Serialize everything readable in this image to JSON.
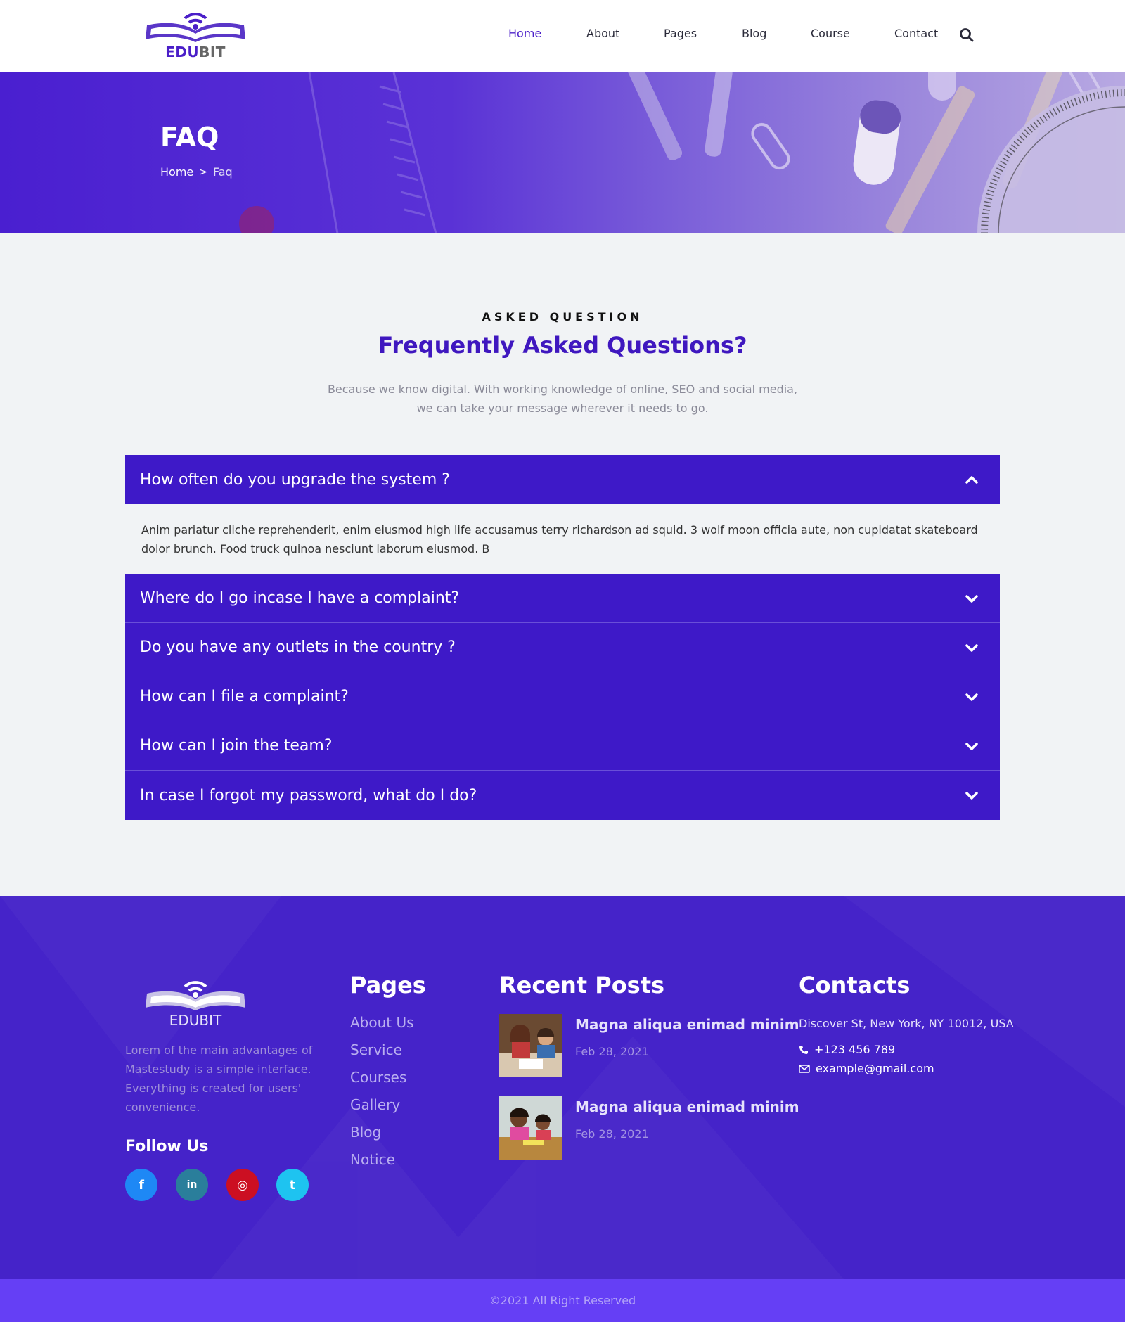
{
  "header": {
    "logo": {
      "part1": "EDU",
      "part2": "BIT"
    },
    "nav": [
      {
        "label": "Home",
        "active": true
      },
      {
        "label": "About",
        "active": false
      },
      {
        "label": "Pages",
        "active": false
      },
      {
        "label": "Blog",
        "active": false
      },
      {
        "label": "Course",
        "active": false
      },
      {
        "label": "Contact",
        "active": false
      }
    ],
    "search_icon": "search-icon"
  },
  "banner": {
    "title": "FAQ",
    "breadcrumb": {
      "home": "Home",
      "separator": ">",
      "current": "Faq"
    }
  },
  "faq": {
    "eyebrow": "ASKED QUESTION",
    "title": "Frequently Asked Questions?",
    "description_line1": "Because we know digital. With working knowledge of online, SEO and social media,",
    "description_line2": "we can take your message wherever it needs to go.",
    "items": [
      {
        "question": "How often do you upgrade the system ?",
        "expanded": true,
        "answer": "Anim pariatur cliche reprehenderit, enim eiusmod high life accusamus terry richardson ad squid. 3 wolf moon officia aute, non cupidatat skateboard dolor brunch. Food truck quinoa nesciunt laborum eiusmod. B"
      },
      {
        "question": "Where do I go incase I have a complaint?",
        "expanded": false
      },
      {
        "question": "Do you have any outlets in the country ?",
        "expanded": false
      },
      {
        "question": "How can I file a complaint?",
        "expanded": false
      },
      {
        "question": "How can I join the team?",
        "expanded": false
      },
      {
        "question": "In case I forgot my password, what do I do?",
        "expanded": false
      }
    ]
  },
  "footer": {
    "logo_text": "EDUBIT",
    "about": "Lorem of the main advantages of Mastestudy is a simple interface. Everything is created for users' convenience.",
    "follow_title": "Follow Us",
    "social": [
      {
        "icon": "facebook-icon",
        "glyph": "f",
        "color": "#1e88f5"
      },
      {
        "icon": "linkedin-icon",
        "glyph": "in",
        "color": "#2a7e9b"
      },
      {
        "icon": "instagram-icon",
        "glyph": "◎",
        "color": "#cc0f22"
      },
      {
        "icon": "twitter-icon",
        "glyph": "t",
        "color": "#1ec3f0"
      }
    ],
    "pages_title": "Pages",
    "pages": [
      "About Us",
      "Service",
      "Courses",
      "Gallery",
      "Blog",
      "Notice"
    ],
    "posts_title": "Recent Posts",
    "posts": [
      {
        "title": "Magna aliqua enimad minim",
        "date": "Feb 28, 2021"
      },
      {
        "title": "Magna aliqua enimad minim",
        "date": "Feb 28, 2021"
      }
    ],
    "contacts_title": "Contacts",
    "address": "Discover St, New York, NY 10012, USA",
    "phone": "+123 456 789",
    "email": "example@gmail.com"
  },
  "copyright": "©2021 All Right Reserved",
  "colors": {
    "brand": "#4a1ec8",
    "accordion": "#3e19c8",
    "footer": "#4523c9",
    "copyright_bar": "#653ff5"
  }
}
